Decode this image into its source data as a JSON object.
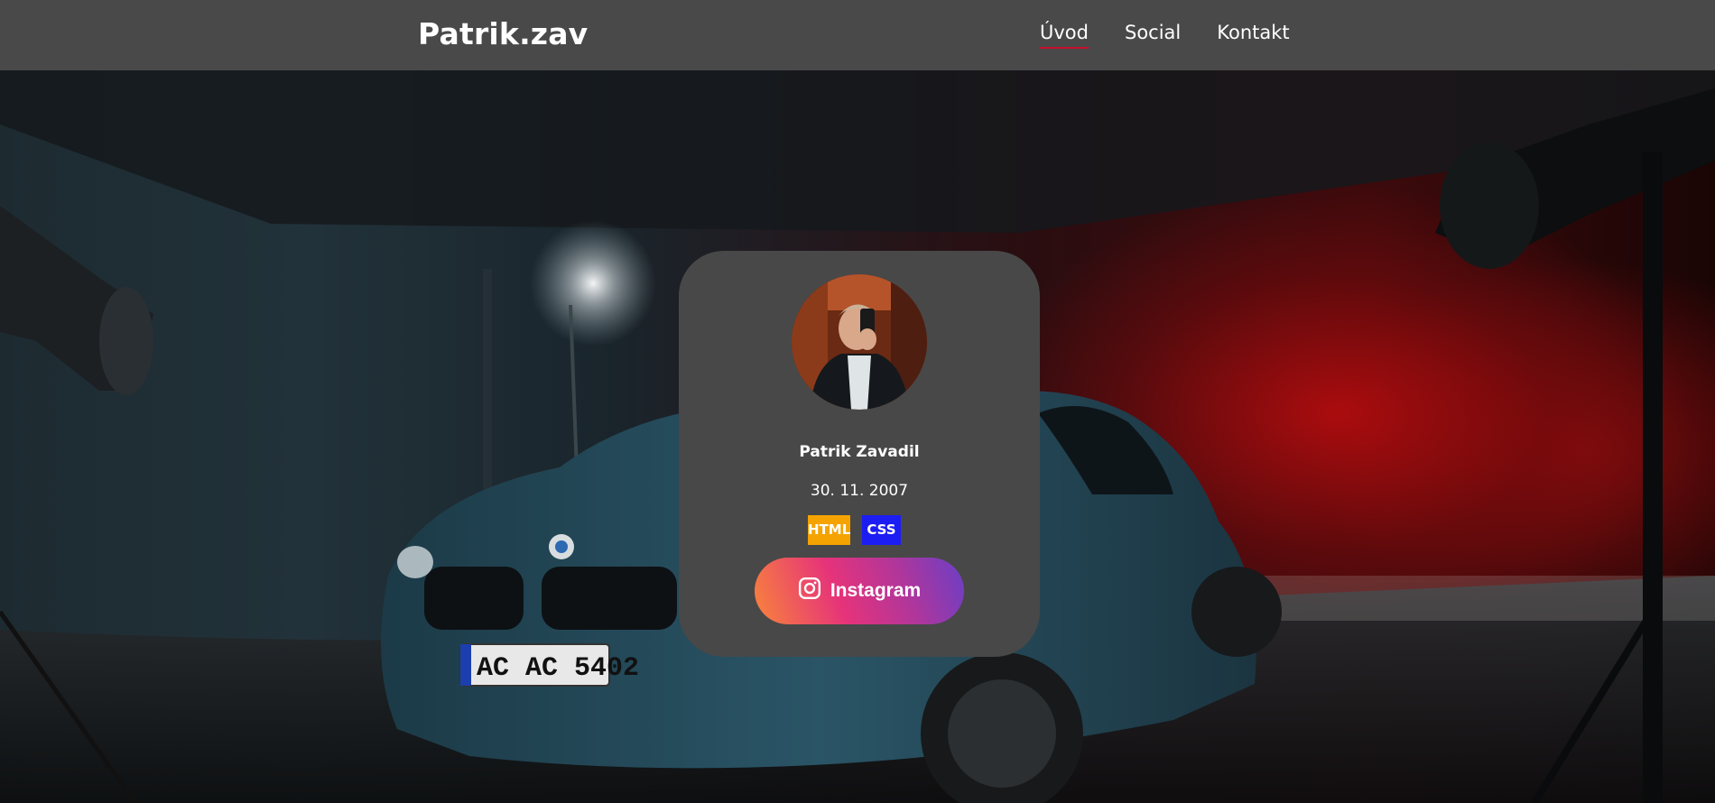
{
  "header": {
    "logo": "Patrik.zav",
    "nav": [
      {
        "label": "Úvod",
        "active": true
      },
      {
        "label": "Social",
        "active": false
      },
      {
        "label": "Kontakt",
        "active": false
      }
    ]
  },
  "hero": {
    "license_plate": "AC AC 5402"
  },
  "card": {
    "name": "Patrik Zavadil",
    "date_of_birth": "30. 11. 2007",
    "tags": [
      {
        "label": "HTML",
        "color": "#f5a300"
      },
      {
        "label": "CSS",
        "color": "#1c1df2"
      }
    ],
    "instagram_button": {
      "label": "Instagram",
      "icon": "instagram-icon"
    }
  },
  "colors": {
    "header_bg": "#494949",
    "card_bg": "#484848",
    "nav_active_underline": "#c8102e"
  }
}
